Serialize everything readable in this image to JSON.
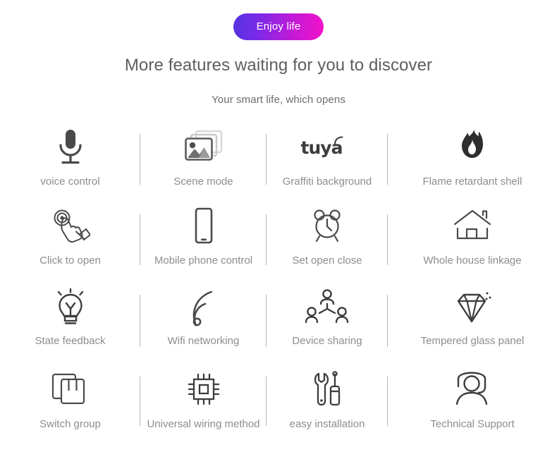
{
  "header": {
    "badge_label": "Enjoy life",
    "badge_gradient_from": "#5433e0",
    "badge_gradient_to": "#f411c8",
    "title": "More features waiting for you to discover",
    "subtitle": "Your smart life, which opens",
    "title_color": "#5e5e5e",
    "label_color": "#8d8d8d"
  },
  "features": [
    {
      "icon": "microphone-icon",
      "label": "voice control"
    },
    {
      "icon": "photo-stack-icon",
      "label": "Scene mode"
    },
    {
      "icon": "tuya-logo-icon",
      "label": "Graffiti background",
      "wordmark": "tuya"
    },
    {
      "icon": "flame-icon",
      "label": "Flame retardant shell"
    },
    {
      "icon": "tap-hand-icon",
      "label": "Click to open"
    },
    {
      "icon": "smartphone-icon",
      "label": "Mobile phone control"
    },
    {
      "icon": "alarm-clock-icon",
      "label": "Set open close"
    },
    {
      "icon": "house-icon",
      "label": "Whole house linkage"
    },
    {
      "icon": "lightbulb-icon",
      "label": "State feedback"
    },
    {
      "icon": "wifi-icon",
      "label": "Wifi networking"
    },
    {
      "icon": "people-sharing-icon",
      "label": "Device sharing"
    },
    {
      "icon": "diamond-icon",
      "label": "Tempered glass panel"
    },
    {
      "icon": "switch-panels-icon",
      "label": "Switch group"
    },
    {
      "icon": "chip-icon",
      "label": "Universal wiring method"
    },
    {
      "icon": "tools-icon",
      "label": "easy installation"
    },
    {
      "icon": "headset-support-icon",
      "label": "Technical Support"
    }
  ]
}
